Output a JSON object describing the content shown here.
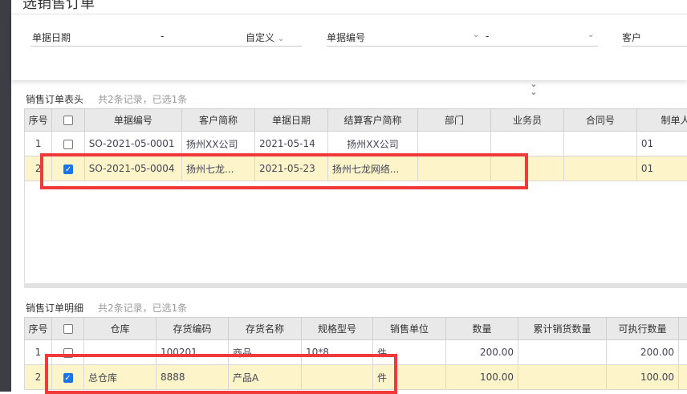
{
  "dialog": {
    "title": "选销售订单"
  },
  "filters": {
    "date_label": "单据日期",
    "date_sep": "-",
    "date_mode": "自定义",
    "code_label": "单据编号",
    "code_sep": "-",
    "customer_label": "客户"
  },
  "header_section": {
    "title": "销售订单表头",
    "count": "共2条记录，已选1条",
    "columns": [
      "序号",
      "",
      "单据编号",
      "客户简称",
      "单据日期",
      "结算客户简称",
      "部门",
      "业务员",
      "合同号",
      "制单人"
    ],
    "rows": [
      {
        "no": "1",
        "checked": false,
        "code": "SO-2021-05-0001",
        "customer": "扬州XX公司",
        "date": "2021-05-14",
        "settle": "扬州XX公司",
        "dept": "",
        "sales": "",
        "contract": "",
        "maker": "01"
      },
      {
        "no": "2",
        "checked": true,
        "code": "SO-2021-05-0004",
        "customer": "扬州七龙...",
        "date": "2021-05-23",
        "settle": "扬州七龙网络...",
        "dept": "",
        "sales": "",
        "contract": "",
        "maker": "01"
      }
    ]
  },
  "detail_section": {
    "title": "销售订单明细",
    "count": "共2条记录，已选1条",
    "columns": [
      "序号",
      "",
      "仓库",
      "存货编码",
      "存货名称",
      "规格型号",
      "销售单位",
      "数量",
      "累计销货数量",
      "可执行数量"
    ],
    "rows": [
      {
        "no": "1",
        "checked": false,
        "warehouse": "",
        "item_code": "100201",
        "item_name": "商品",
        "spec": "10*8",
        "unit": "件",
        "qty": "200.00",
        "cum": "",
        "exec": "200.00"
      },
      {
        "no": "2",
        "checked": true,
        "warehouse": "总仓库",
        "item_code": "8888",
        "item_name": "产品A",
        "spec": "",
        "unit": "件",
        "qty": "100.00",
        "cum": "",
        "exec": "100.00"
      }
    ]
  },
  "colors": {
    "selected_row": "#fdf5c9",
    "highlight_box": "#f03a3a",
    "checkbox": "#1a73e8"
  }
}
